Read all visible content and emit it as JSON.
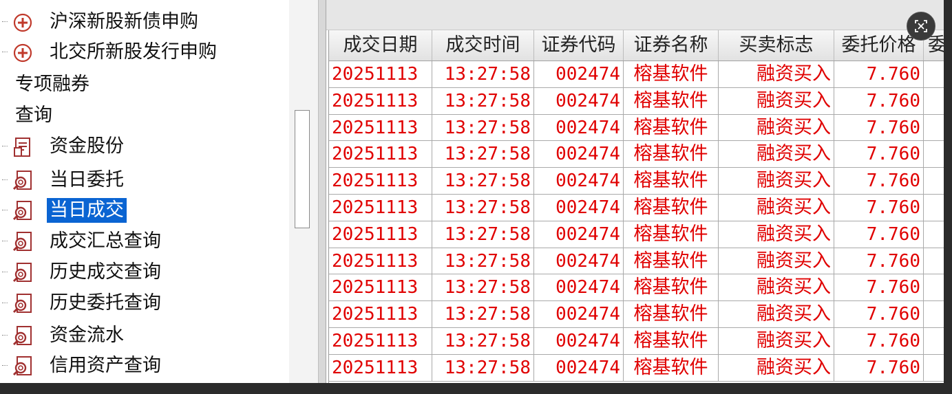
{
  "tree": {
    "items": [
      {
        "label": "沪深新股新债申购",
        "icon": "plus-circle-icon",
        "type": "leaf"
      },
      {
        "label": "北交所新股发行申购",
        "icon": "plus-circle-icon",
        "type": "leaf"
      },
      {
        "label": "专项融券",
        "type": "heading"
      },
      {
        "label": "查询",
        "type": "heading"
      },
      {
        "label": "资金股份",
        "icon": "document-icon",
        "type": "leaf"
      },
      {
        "label": "当日委托",
        "icon": "search-doc-icon",
        "type": "leaf"
      },
      {
        "label": "当日成交",
        "icon": "search-doc-icon",
        "type": "leaf",
        "selected": true
      },
      {
        "label": "成交汇总查询",
        "icon": "search-doc-icon",
        "type": "leaf"
      },
      {
        "label": "历史成交查询",
        "icon": "search-doc-icon",
        "type": "leaf"
      },
      {
        "label": "历史委托查询",
        "icon": "search-doc-icon",
        "type": "leaf"
      },
      {
        "label": "资金流水",
        "icon": "search-doc-icon",
        "type": "leaf"
      },
      {
        "label": "信用资产查询",
        "icon": "search-doc-icon",
        "type": "leaf"
      }
    ]
  },
  "grid": {
    "columns": [
      "成交日期",
      "成交时间",
      "证券代码",
      "证券名称",
      "买卖标志",
      "委托价格",
      "委"
    ],
    "rows": [
      [
        "20251113",
        "13:27:58",
        "002474",
        "榕基软件",
        "融资买入",
        "7.760"
      ],
      [
        "20251113",
        "13:27:58",
        "002474",
        "榕基软件",
        "融资买入",
        "7.760"
      ],
      [
        "20251113",
        "13:27:58",
        "002474",
        "榕基软件",
        "融资买入",
        "7.760"
      ],
      [
        "20251113",
        "13:27:58",
        "002474",
        "榕基软件",
        "融资买入",
        "7.760"
      ],
      [
        "20251113",
        "13:27:58",
        "002474",
        "榕基软件",
        "融资买入",
        "7.760"
      ],
      [
        "20251113",
        "13:27:58",
        "002474",
        "榕基软件",
        "融资买入",
        "7.760"
      ],
      [
        "20251113",
        "13:27:58",
        "002474",
        "榕基软件",
        "融资买入",
        "7.760"
      ],
      [
        "20251113",
        "13:27:58",
        "002474",
        "榕基软件",
        "融资买入",
        "7.760"
      ],
      [
        "20251113",
        "13:27:58",
        "002474",
        "榕基软件",
        "融资买入",
        "7.760"
      ],
      [
        "20251113",
        "13:27:58",
        "002474",
        "榕基软件",
        "融资买入",
        "7.760"
      ],
      [
        "20251113",
        "13:27:58",
        "002474",
        "榕基软件",
        "融资买入",
        "7.760"
      ],
      [
        "20251113",
        "13:27:58",
        "002474",
        "榕基软件",
        "融资买入",
        "7.760"
      ]
    ]
  },
  "colors": {
    "selection": "#0a64d2",
    "row_text": "#e00000",
    "icon_red": "#c0392b"
  }
}
